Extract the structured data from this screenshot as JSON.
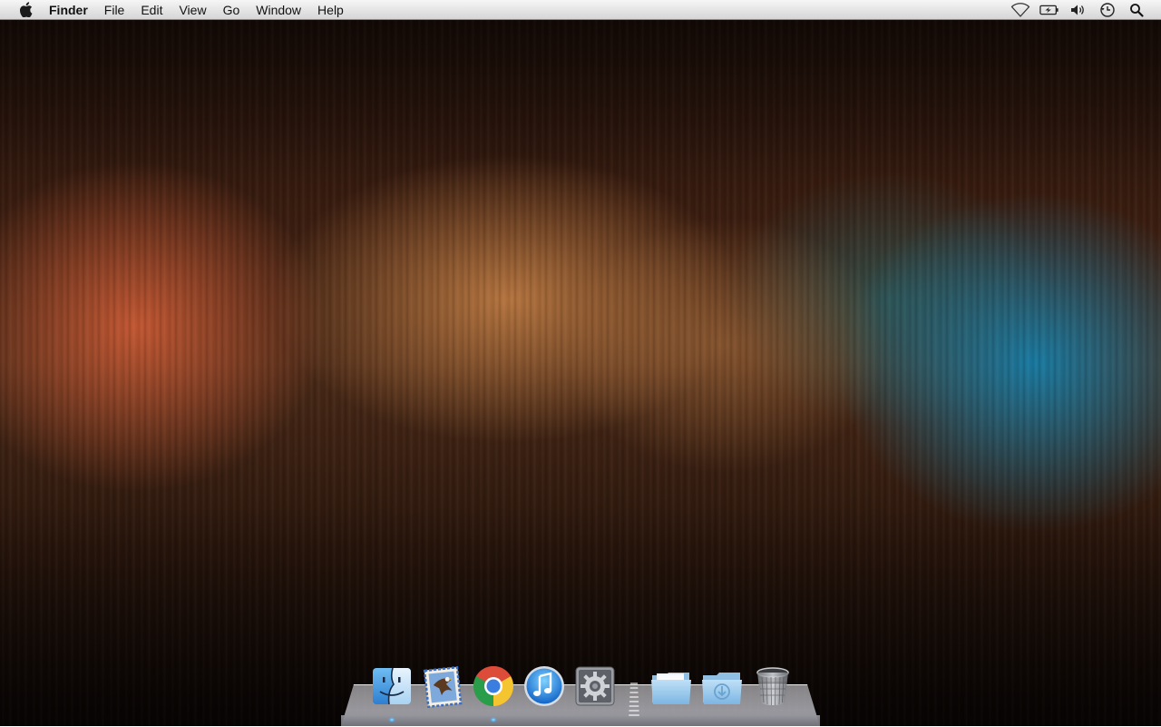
{
  "menubar": {
    "apple_icon": "apple-logo-icon",
    "app_name": "Finder",
    "items": [
      "File",
      "Edit",
      "View",
      "Go",
      "Window",
      "Help"
    ],
    "status_icons": [
      "wifi-icon",
      "battery-icon",
      "volume-icon",
      "time-machine-icon",
      "spotlight-icon"
    ]
  },
  "dock": {
    "apps": [
      {
        "icon": "finder-icon",
        "running": true
      },
      {
        "icon": "mail-icon",
        "running": false
      },
      {
        "icon": "chrome-icon",
        "running": true
      },
      {
        "icon": "itunes-icon",
        "running": false
      },
      {
        "icon": "system-preferences-icon",
        "running": false
      }
    ],
    "stacks": [
      {
        "icon": "documents-folder-icon"
      },
      {
        "icon": "downloads-folder-icon"
      },
      {
        "icon": "trash-icon"
      }
    ]
  },
  "colors": {
    "wallpaper_orange": "#d75f37",
    "wallpaper_teal": "#1482af",
    "menubar_bg": "#e4e4e4"
  }
}
